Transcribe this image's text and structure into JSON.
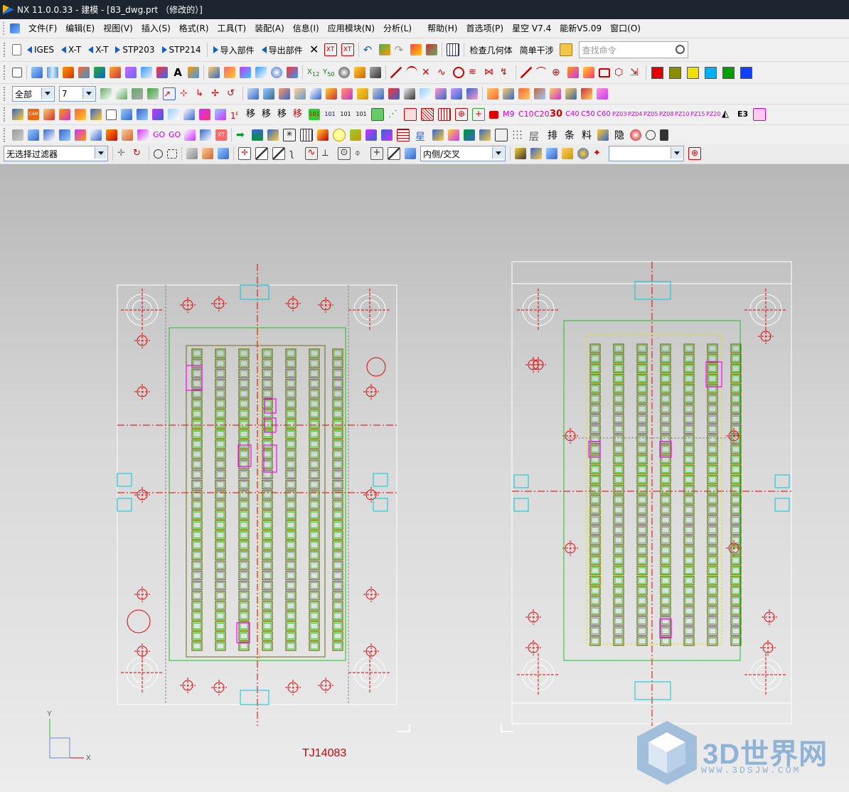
{
  "window": {
    "title": "NX 11.0.0.33 - 建模 - [83_dwg.prt （修改的）]"
  },
  "menu": [
    "文件(F)",
    "编辑(E)",
    "视图(V)",
    "插入(S)",
    "格式(R)",
    "工具(T)",
    "装配(A)",
    "信息(I)",
    "应用模块(N)",
    "分析(L)",
    "帮助(H)",
    "首选项(P)",
    "星空 V7.4",
    "能新V5.09",
    "窗口(O)"
  ],
  "toolbar1": {
    "iges": "IGES",
    "xt1": "X-T",
    "xt2": "X-T",
    "stp203": "STP203",
    "stp214": "STP214",
    "import_part": "导入部件",
    "export_part": "导出部件",
    "check_geometry": "检查几何体",
    "simple_interference": "简单干涉",
    "search_placeholder": "查找命令"
  },
  "toolbar3": {
    "selection_scope": "全部",
    "layer_value": "7"
  },
  "toolbar5": {
    "chars": [
      "排",
      "条",
      "料",
      "隐"
    ]
  },
  "selbar": {
    "filter": "无选择过滤器",
    "intersect_mode": "内侧/交叉",
    "empty_select": ""
  },
  "colors": {
    "swatches": [
      "#e60000",
      "#8c8c00",
      "#f0e000",
      "#00b0f0",
      "#00a000",
      "#1040ff"
    ]
  },
  "canvas": {
    "drawing_label": "TJ14083",
    "axis_x_label": "X",
    "axis_y_label": "Y",
    "watermark": "3D世界网",
    "watermark_url": "WWW.3DSJW.COM"
  }
}
